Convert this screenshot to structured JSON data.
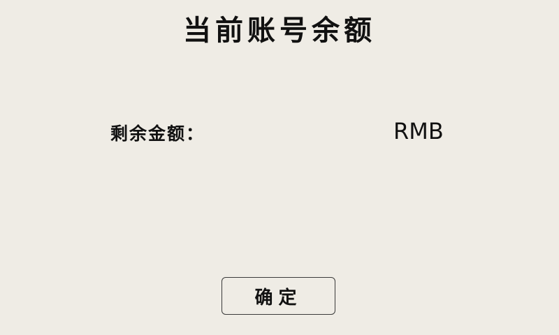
{
  "header": {
    "title": "当前账号余额"
  },
  "balance": {
    "label": "剩余金额：",
    "amount": "",
    "currency": "RMB"
  },
  "actions": {
    "confirm_label": "确定"
  }
}
